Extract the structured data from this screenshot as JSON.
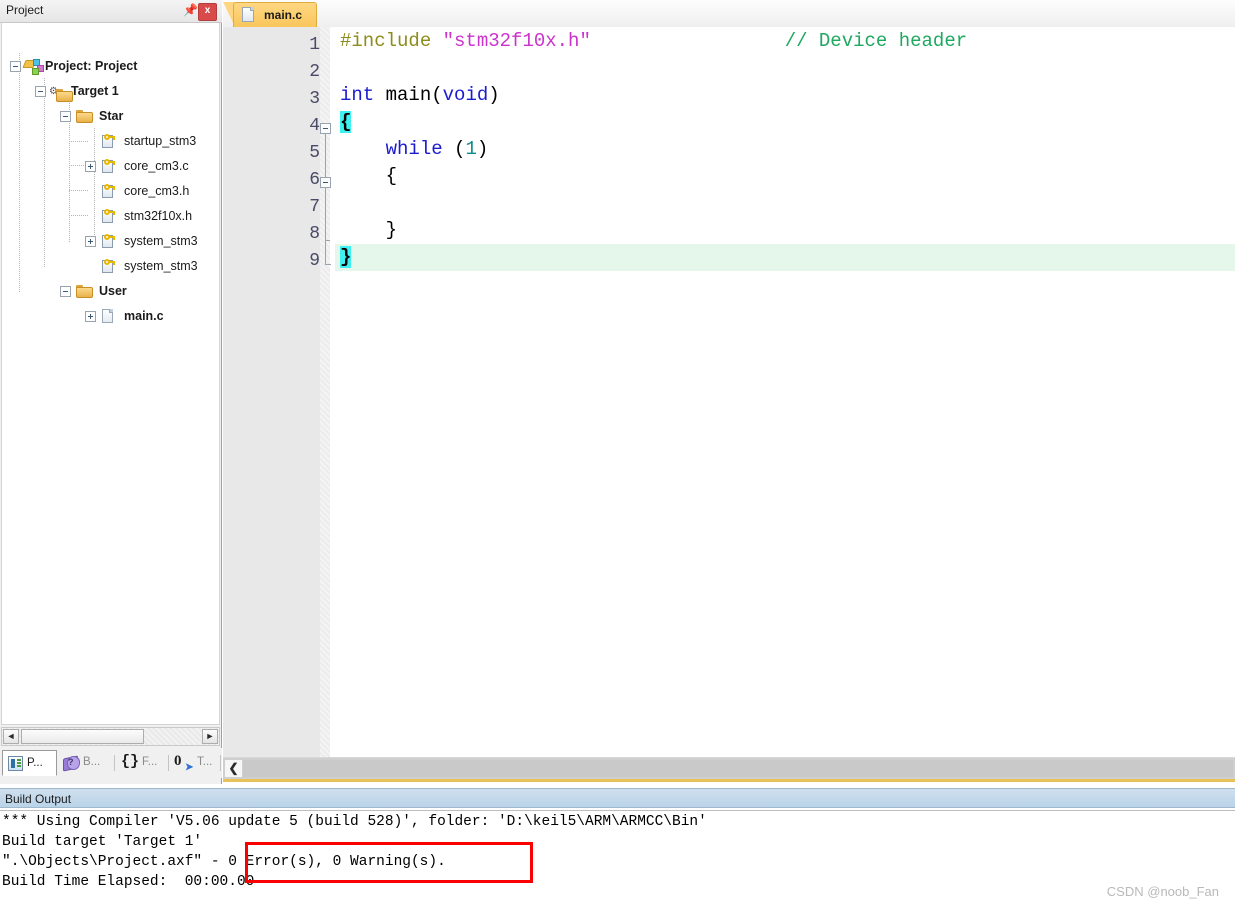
{
  "project_panel": {
    "title": "Project",
    "pin_icon": "pin-icon",
    "close_label": "x",
    "tree": [
      {
        "label": "Project: Project",
        "icon": "project-icon",
        "depth": 0,
        "toggle": "minus"
      },
      {
        "label": "Target 1",
        "icon": "target-icon",
        "depth": 1,
        "toggle": "minus"
      },
      {
        "label": "Star",
        "icon": "folder-icon",
        "depth": 2,
        "toggle": "minus"
      },
      {
        "label": "startup_stm3",
        "icon": "source-file-icon",
        "depth": 3,
        "toggle": "none"
      },
      {
        "label": "core_cm3.c",
        "icon": "source-file-icon",
        "depth": 3,
        "toggle": "plus"
      },
      {
        "label": "core_cm3.h",
        "icon": "source-file-icon",
        "depth": 3,
        "toggle": "none"
      },
      {
        "label": "stm32f10x.h",
        "icon": "source-file-icon",
        "depth": 3,
        "toggle": "none"
      },
      {
        "label": "system_stm3",
        "icon": "source-file-icon",
        "depth": 3,
        "toggle": "plus"
      },
      {
        "label": "system_stm3",
        "icon": "source-file-icon",
        "depth": 3,
        "toggle": "none"
      },
      {
        "label": "User",
        "icon": "folder-icon",
        "depth": 2,
        "toggle": "minus"
      },
      {
        "label": "main.c",
        "icon": "plain-file-icon",
        "depth": 3,
        "toggle": "plus"
      }
    ],
    "hscroll": {
      "left_arrow": "◄",
      "right_arrow": "►"
    },
    "tabs": [
      {
        "label": "P...",
        "icon": "project-view-icon",
        "active": true
      },
      {
        "label": "B...",
        "icon": "books-icon",
        "active": false
      },
      {
        "label": "F...",
        "icon": "functions-icon",
        "active": false
      },
      {
        "label": "T...",
        "icon": "templates-icon",
        "active": false
      }
    ]
  },
  "editor": {
    "tab": {
      "label": "main.c",
      "icon": "file-icon"
    },
    "line_numbers": [
      "1",
      "2",
      "3",
      "4",
      "5",
      "6",
      "7",
      "8",
      "9"
    ],
    "code_lines": [
      {
        "n": 1,
        "segments": [
          {
            "t": "#include ",
            "c": "pre"
          },
          {
            "t": "\"stm32f10x.h\"",
            "c": "str"
          },
          {
            "t": "                 ",
            "c": "plain"
          },
          {
            "t": "// Device header",
            "c": "cmt"
          }
        ]
      },
      {
        "n": 2,
        "segments": []
      },
      {
        "n": 3,
        "segments": [
          {
            "t": "int",
            "c": "kw"
          },
          {
            "t": " main(",
            "c": "plain"
          },
          {
            "t": "void",
            "c": "kw"
          },
          {
            "t": ")",
            "c": "plain"
          }
        ]
      },
      {
        "n": 4,
        "segments": [
          {
            "t": "{",
            "c": "brace-sel"
          }
        ]
      },
      {
        "n": 5,
        "segments": [
          {
            "t": "    ",
            "c": "plain"
          },
          {
            "t": "while",
            "c": "kw"
          },
          {
            "t": " (",
            "c": "plain"
          },
          {
            "t": "1",
            "c": "num"
          },
          {
            "t": ")",
            "c": "plain"
          }
        ]
      },
      {
        "n": 6,
        "segments": [
          {
            "t": "    {",
            "c": "plain"
          }
        ]
      },
      {
        "n": 7,
        "segments": []
      },
      {
        "n": 8,
        "segments": [
          {
            "t": "    }",
            "c": "plain"
          }
        ]
      },
      {
        "n": 9,
        "segments": [
          {
            "t": "}",
            "c": "brace-sel"
          }
        ]
      }
    ],
    "hscroll": {
      "left_arrow": "❮"
    }
  },
  "build_output": {
    "title": "Build Output",
    "lines": [
      "*** Using Compiler 'V5.06 update 5 (build 528)', folder: 'D:\\keil5\\ARM\\ARMCC\\Bin'",
      "Build target 'Target 1'",
      "\".\\Objects\\Project.axf\" - 0 Error(s), 0 Warning(s).",
      "Build Time Elapsed:  00:00.00"
    ],
    "highlight_color": "#fb0000"
  },
  "watermark": "CSDN @noob_Fan"
}
